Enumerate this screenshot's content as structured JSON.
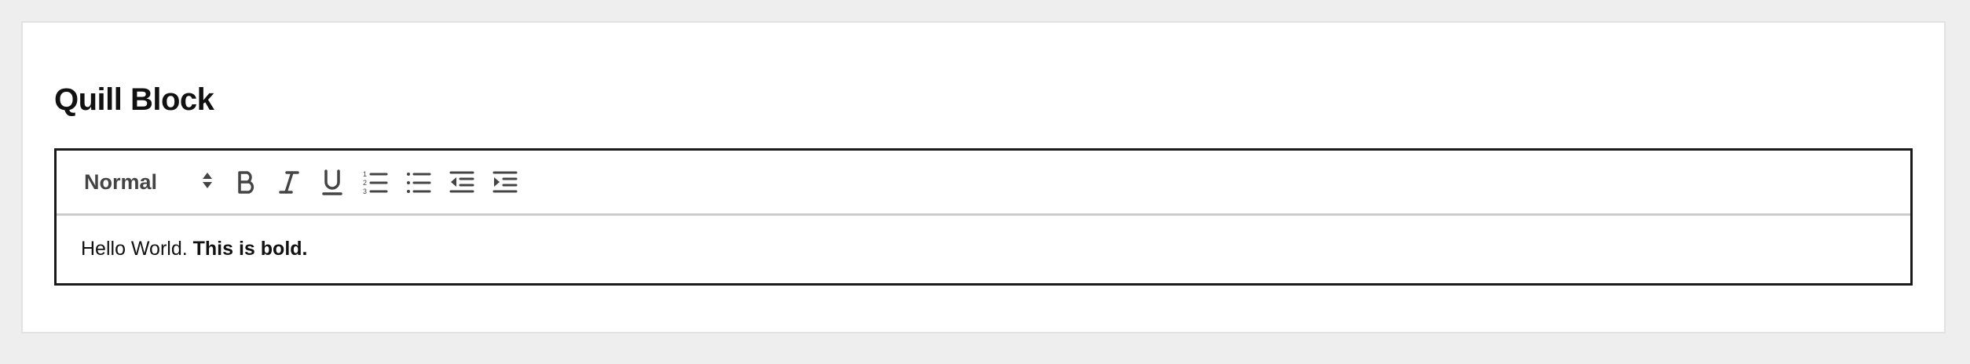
{
  "page": {
    "title": "Quill Block"
  },
  "toolbar": {
    "header_select": {
      "value": "Normal"
    },
    "buttons": [
      {
        "name": "bold-button",
        "icon": "bold-icon"
      },
      {
        "name": "italic-button",
        "icon": "italic-icon"
      },
      {
        "name": "underline-button",
        "icon": "underline-icon"
      },
      {
        "name": "ordered-list-button",
        "icon": "ordered-list-icon"
      },
      {
        "name": "bullet-list-button",
        "icon": "bullet-list-icon"
      },
      {
        "name": "outdent-button",
        "icon": "outdent-icon"
      },
      {
        "name": "indent-button",
        "icon": "indent-icon"
      }
    ]
  },
  "editor": {
    "content_plain": "Hello World. ",
    "content_bold": "This is bold."
  },
  "colors": {
    "background": "#eeeeee",
    "card": "#ffffff",
    "editor_border": "#1a1a1a",
    "toolbar_divider": "#cccccc",
    "icon": "#444444"
  }
}
